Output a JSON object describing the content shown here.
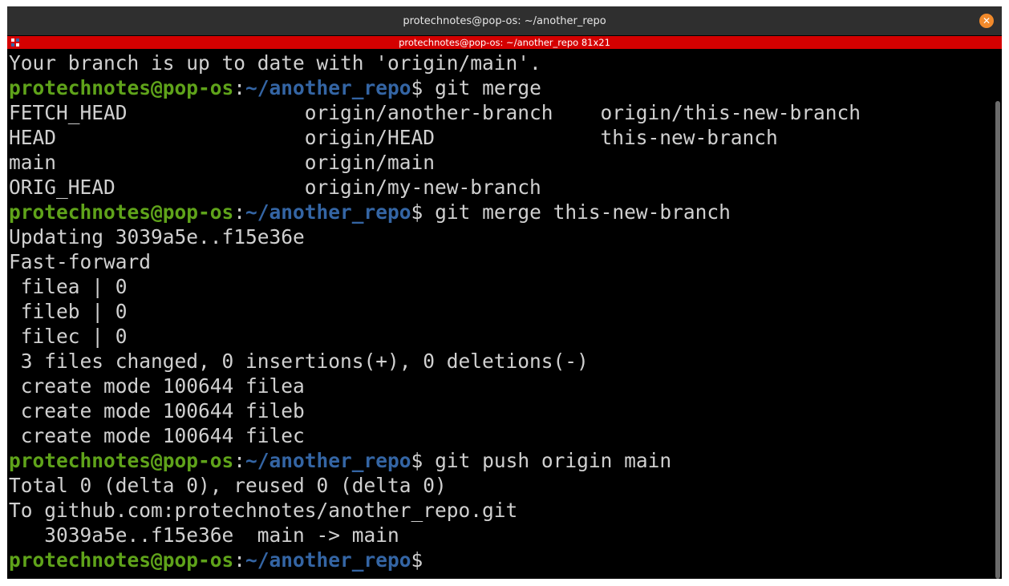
{
  "window": {
    "title": "protechnotes@pop-os: ~/another_repo",
    "subtitle": "protechnotes@pop-os: ~/another_repo 81x21",
    "close_glyph": "✕"
  },
  "colors": {
    "prompt_user": "#5fa31a",
    "prompt_path": "#3465a4",
    "subtitle_bar": "#d40000",
    "close_button": "#f28a2b"
  },
  "terminal": {
    "lines": [
      {
        "text": "Your branch is up to date with 'origin/main'."
      },
      {
        "prompt": {
          "user": "protechnotes@pop-os",
          "sep": ":",
          "path": "~/another_repo",
          "sign": "$"
        },
        "command": " git merge"
      },
      {
        "text": "FETCH_HEAD               origin/another-branch    origin/this-new-branch"
      },
      {
        "text": "HEAD                     origin/HEAD              this-new-branch"
      },
      {
        "text": "main                     origin/main"
      },
      {
        "text": "ORIG_HEAD                origin/my-new-branch"
      },
      {
        "prompt": {
          "user": "protechnotes@pop-os",
          "sep": ":",
          "path": "~/another_repo",
          "sign": "$"
        },
        "command": " git merge this-new-branch"
      },
      {
        "text": "Updating 3039a5e..f15e36e"
      },
      {
        "text": "Fast-forward"
      },
      {
        "text": " filea | 0"
      },
      {
        "text": " fileb | 0"
      },
      {
        "text": " filec | 0"
      },
      {
        "text": " 3 files changed, 0 insertions(+), 0 deletions(-)"
      },
      {
        "text": " create mode 100644 filea"
      },
      {
        "text": " create mode 100644 fileb"
      },
      {
        "text": " create mode 100644 filec"
      },
      {
        "prompt": {
          "user": "protechnotes@pop-os",
          "sep": ":",
          "path": "~/another_repo",
          "sign": "$"
        },
        "command": " git push origin main"
      },
      {
        "text": "Total 0 (delta 0), reused 0 (delta 0)"
      },
      {
        "text": "To github.com:protechnotes/another_repo.git"
      },
      {
        "text": "   3039a5e..f15e36e  main -> main"
      },
      {
        "prompt": {
          "user": "protechnotes@pop-os",
          "sep": ":",
          "path": "~/another_repo",
          "sign": "$"
        },
        "command": ""
      }
    ]
  }
}
